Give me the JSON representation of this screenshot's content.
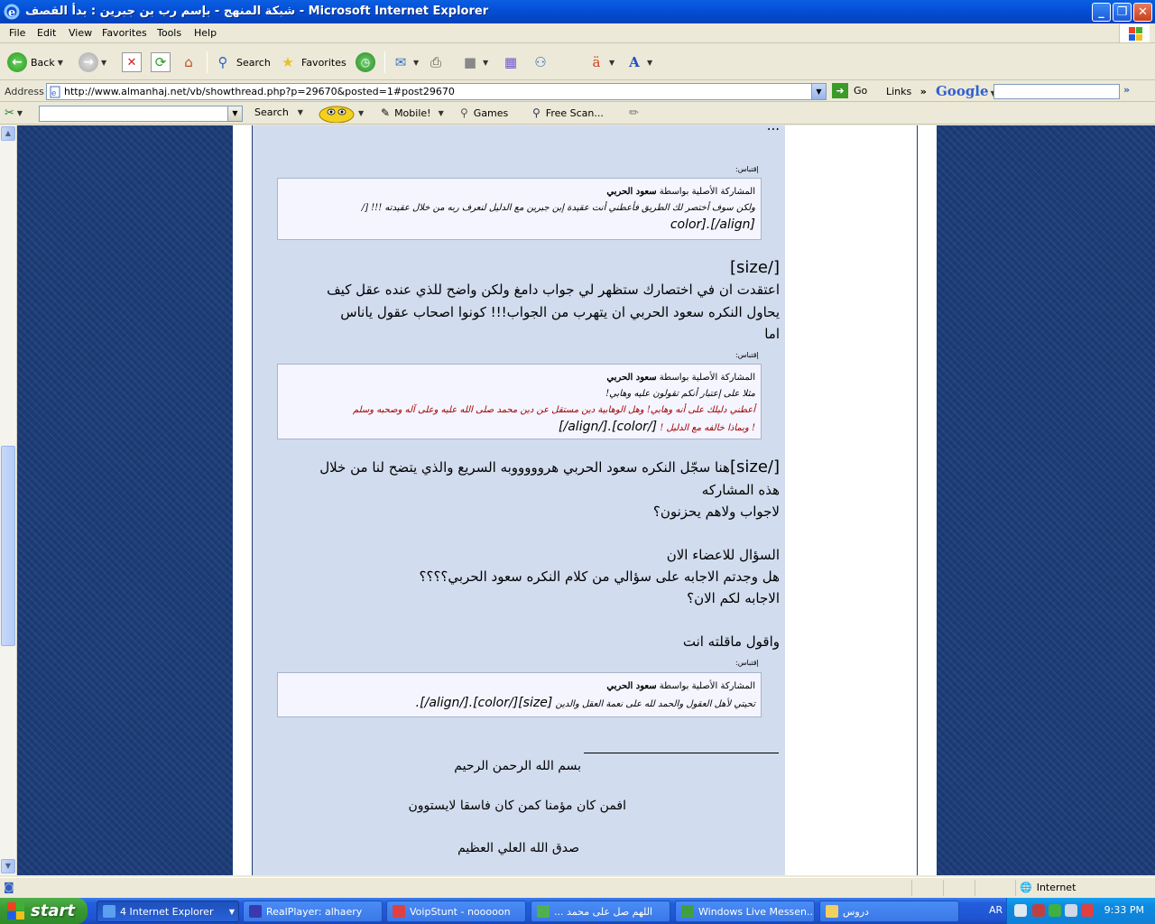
{
  "window": {
    "title": "شبكة المنهج - بإسم رب بن جبرين : بدأ القصف - Microsoft Internet Explorer",
    "minimize": "_",
    "maximize": "❐",
    "close": "✕"
  },
  "menu": [
    "File",
    "Edit",
    "View",
    "Favorites",
    "Tools",
    "Help"
  ],
  "toolbar": {
    "back_label": "Back",
    "search_label": "Search",
    "favorites_label": "Favorites"
  },
  "address": {
    "label": "Address",
    "url": "http://www.almanhaj.net/vb/showthread.php?p=29670&posted=1#post29670",
    "go_label": "Go",
    "links_label": "Links",
    "chevron": "»",
    "google_label": "Google",
    "google_chevron": "»"
  },
  "toolbar2": {
    "search_label": "Search",
    "mobile_label": "Mobile!",
    "games_label": "Games",
    "freescan_label": "Free Scan..."
  },
  "post": {
    "top_partial": "...",
    "quote_label": "إقتباس:",
    "quote1": {
      "header_prefix": "المشاركة الأصلية بواسطة",
      "author": "سعود الحربي",
      "line1": "ولكن سوف أختصر لك الطريق فأعطني أنت عقيدة إبن جبرين مع الدليل لنعرف ربه من خلال عقيدته !!! [/",
      "line2": "color].[/align]"
    },
    "para1": {
      "tag": "[/size]",
      "line1": "اعتقدت ان في اختصارك ستظهر لي جواب دامغ ولكن واضح للذي عنده عقل كيف",
      "line2": "يحاول النكره سعود الحربي ان يتهرب من الجواب!!! كونوا اصحاب عقول ياناس",
      "line3": "اما"
    },
    "quote2": {
      "header_prefix": "المشاركة الأصلية بواسطة",
      "author": "سعود الحربي",
      "line1": "مثلا على إعتبار أنكم تقولون عليه وهابي!",
      "line2": "أعطني دليلك على أنه وهابي! وهل الوهابية دين مستقل عن دين محمد صلى الله عليه وعلى آله وصحبه وسلم",
      "line3": "! وبماذا خالفه مع الدليل !",
      "line3_tag": "[/color].[/align/]"
    },
    "para2": {
      "tag": "[/size]",
      "line1": "هنا سجّل النكره سعود الحربي هروووووبه السريع والذي يتضح لنا من خلال",
      "line2": "هذه المشاركه",
      "line3": "لاجواب ولاهم يحزنون؟",
      "line4": "السؤال للاعضاء الان",
      "line5": "هل وجدتم الاجابه على سؤالي من كلام النكره سعود الحربي؟؟؟؟",
      "line6": "الاجابه لكم الان؟",
      "line7": "واقول ماقلته انت"
    },
    "quote3": {
      "header_prefix": "المشاركة الأصلية بواسطة",
      "author": "سعود الحربي",
      "line1": "تحيتي لأهل العقول والحمد لله على نعمة العقل والدين",
      "line1_tag": "[size][/color].[/align/]."
    },
    "signature": {
      "line1": "بسم الله الرحمن الرحيم",
      "line2": "افمن كان مؤمنا كمن كان فاسقا لايستوون",
      "line3": "صدق الله العلي العظيم"
    }
  },
  "status": {
    "zone_label": "Internet"
  },
  "taskbar": {
    "start_label": "start",
    "tasks": [
      "4 Internet Explorer",
      "RealPlayer: alhaery",
      "VoipStunt - nooooon",
      "... اللهم صل على محمد",
      "Windows Live Messen...",
      "دروس"
    ],
    "lang": "AR",
    "clock": "9:33 PM"
  },
  "colors": {
    "post_bg": "#d1dcee",
    "page_bg": "#1c3c78",
    "quote_red": "#a00000"
  }
}
